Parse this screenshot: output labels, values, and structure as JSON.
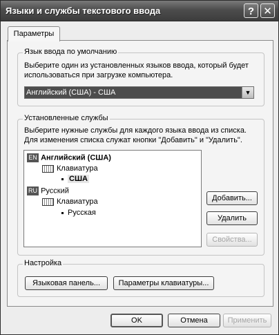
{
  "window": {
    "title": "Языки и службы текстового ввода",
    "help_label": "?",
    "close_label": "✕"
  },
  "tabs": [
    {
      "label": "Параметры"
    }
  ],
  "default_language": {
    "group_label": "Язык ввода по умолчанию",
    "description_line1": "Выберите один из установленных языков ввода, который будет",
    "description_line2": "использоваться при загрузке компьютера.",
    "selected": "Английский (США) - США"
  },
  "installed_services": {
    "group_label": "Установленные службы",
    "description_line1": "Выберите нужные службы для каждого языка ввода из списка.",
    "description_line2": "Для изменения списка служат кнопки \"Добавить\" и \"Удалить\".",
    "languages": [
      {
        "code": "EN",
        "name": "Английский (США)",
        "category": "Клавиатура",
        "layout": "США",
        "selected": true
      },
      {
        "code": "RU",
        "name": "Русский",
        "category": "Клавиатура",
        "layout": "Русская",
        "selected": false
      }
    ],
    "add_button": "Добавить...",
    "remove_button": "Удалить",
    "properties_button": "Свойства..."
  },
  "settings": {
    "group_label": "Настройка",
    "language_bar_button": "Языковая панель...",
    "keyboard_settings_button": "Параметры клавиатуры..."
  },
  "footer": {
    "ok": "OK",
    "cancel": "Отмена",
    "apply": "Применить"
  }
}
